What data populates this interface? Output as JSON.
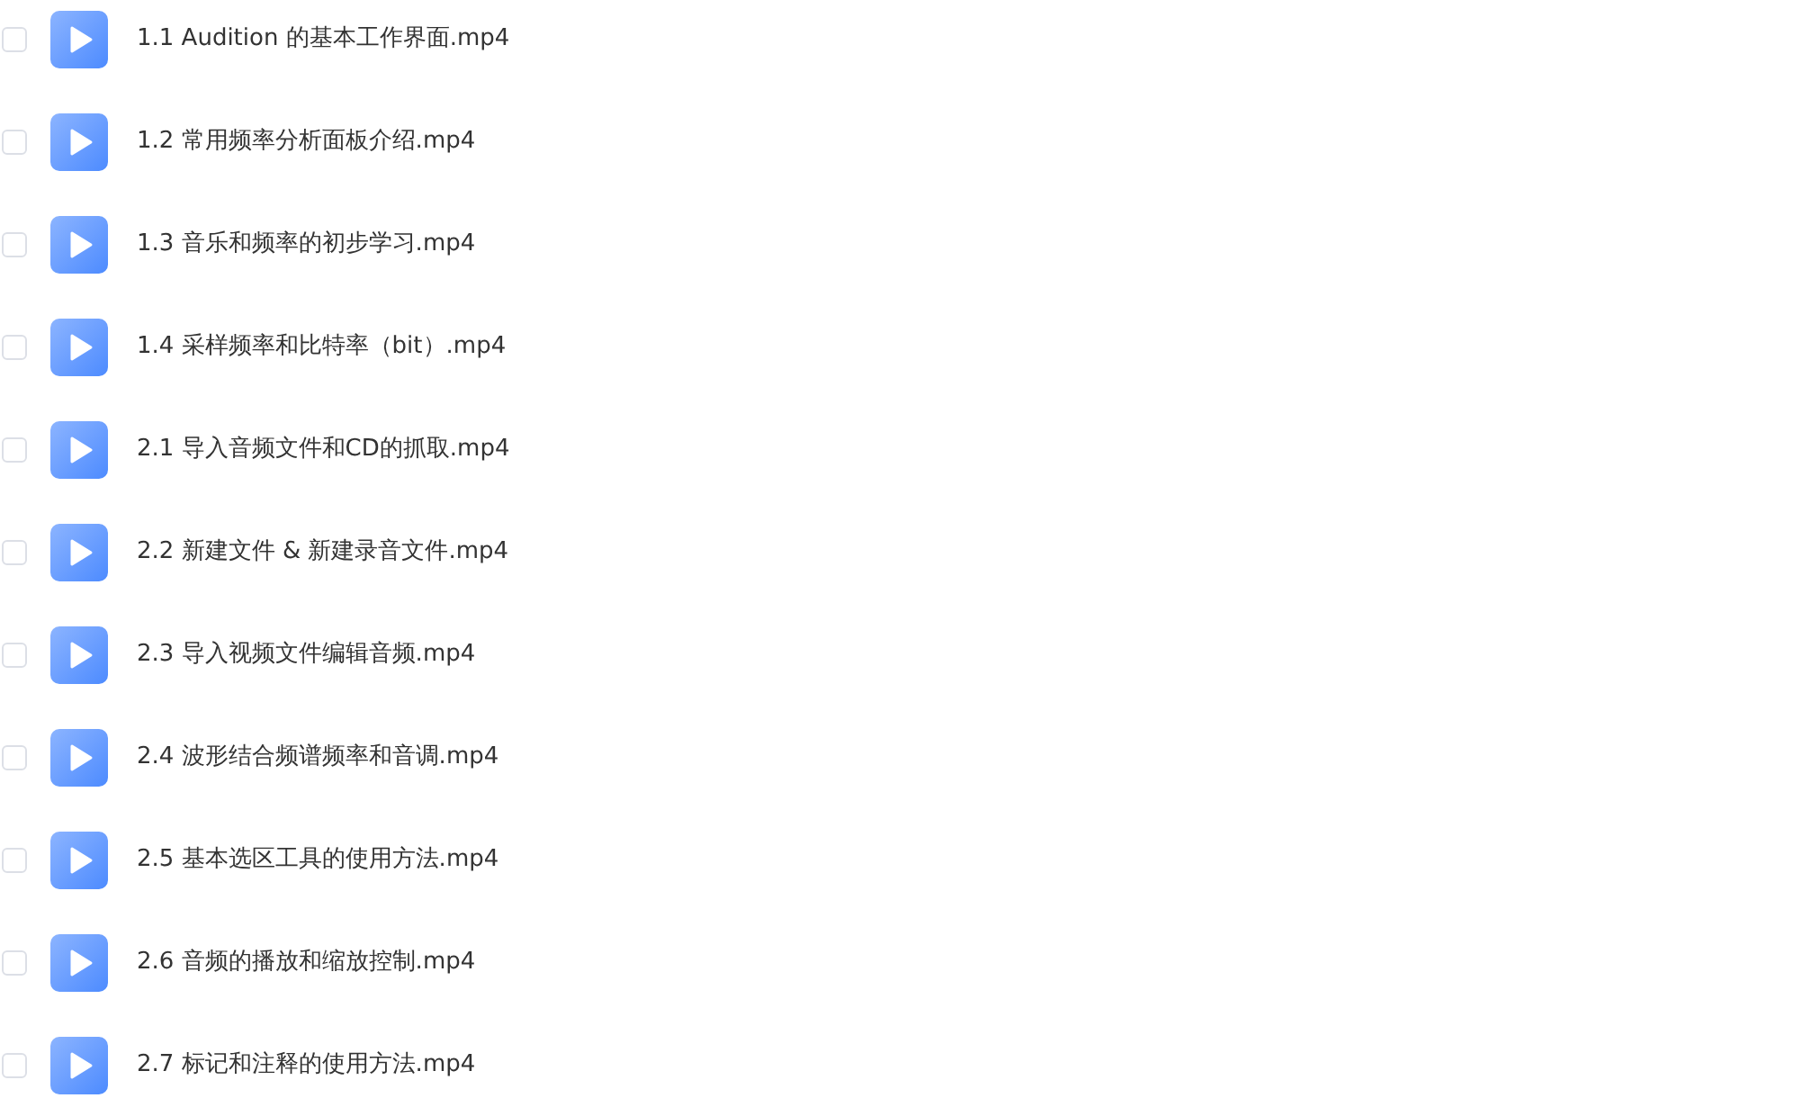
{
  "files": [
    {
      "name": "1.1 Audition 的基本工作界面.mp4",
      "checked": false
    },
    {
      "name": "1.2 常用频率分析面板介绍.mp4",
      "checked": false
    },
    {
      "name": "1.3 音乐和频率的初步学习.mp4",
      "checked": false
    },
    {
      "name": "1.4 采样频率和比特率（bit）.mp4",
      "checked": false
    },
    {
      "name": "2.1 导入音频文件和CD的抓取.mp4",
      "checked": false
    },
    {
      "name": "2.2 新建文件 & 新建录音文件.mp4",
      "checked": false
    },
    {
      "name": "2.3 导入视频文件编辑音频.mp4",
      "checked": false
    },
    {
      "name": "2.4 波形结合频谱频率和音调.mp4",
      "checked": false
    },
    {
      "name": "2.5 基本选区工具的使用方法.mp4",
      "checked": false
    },
    {
      "name": "2.6 音频的播放和缩放控制.mp4",
      "checked": false
    },
    {
      "name": "2.7 标记和注释的使用方法.mp4",
      "checked": false
    }
  ]
}
